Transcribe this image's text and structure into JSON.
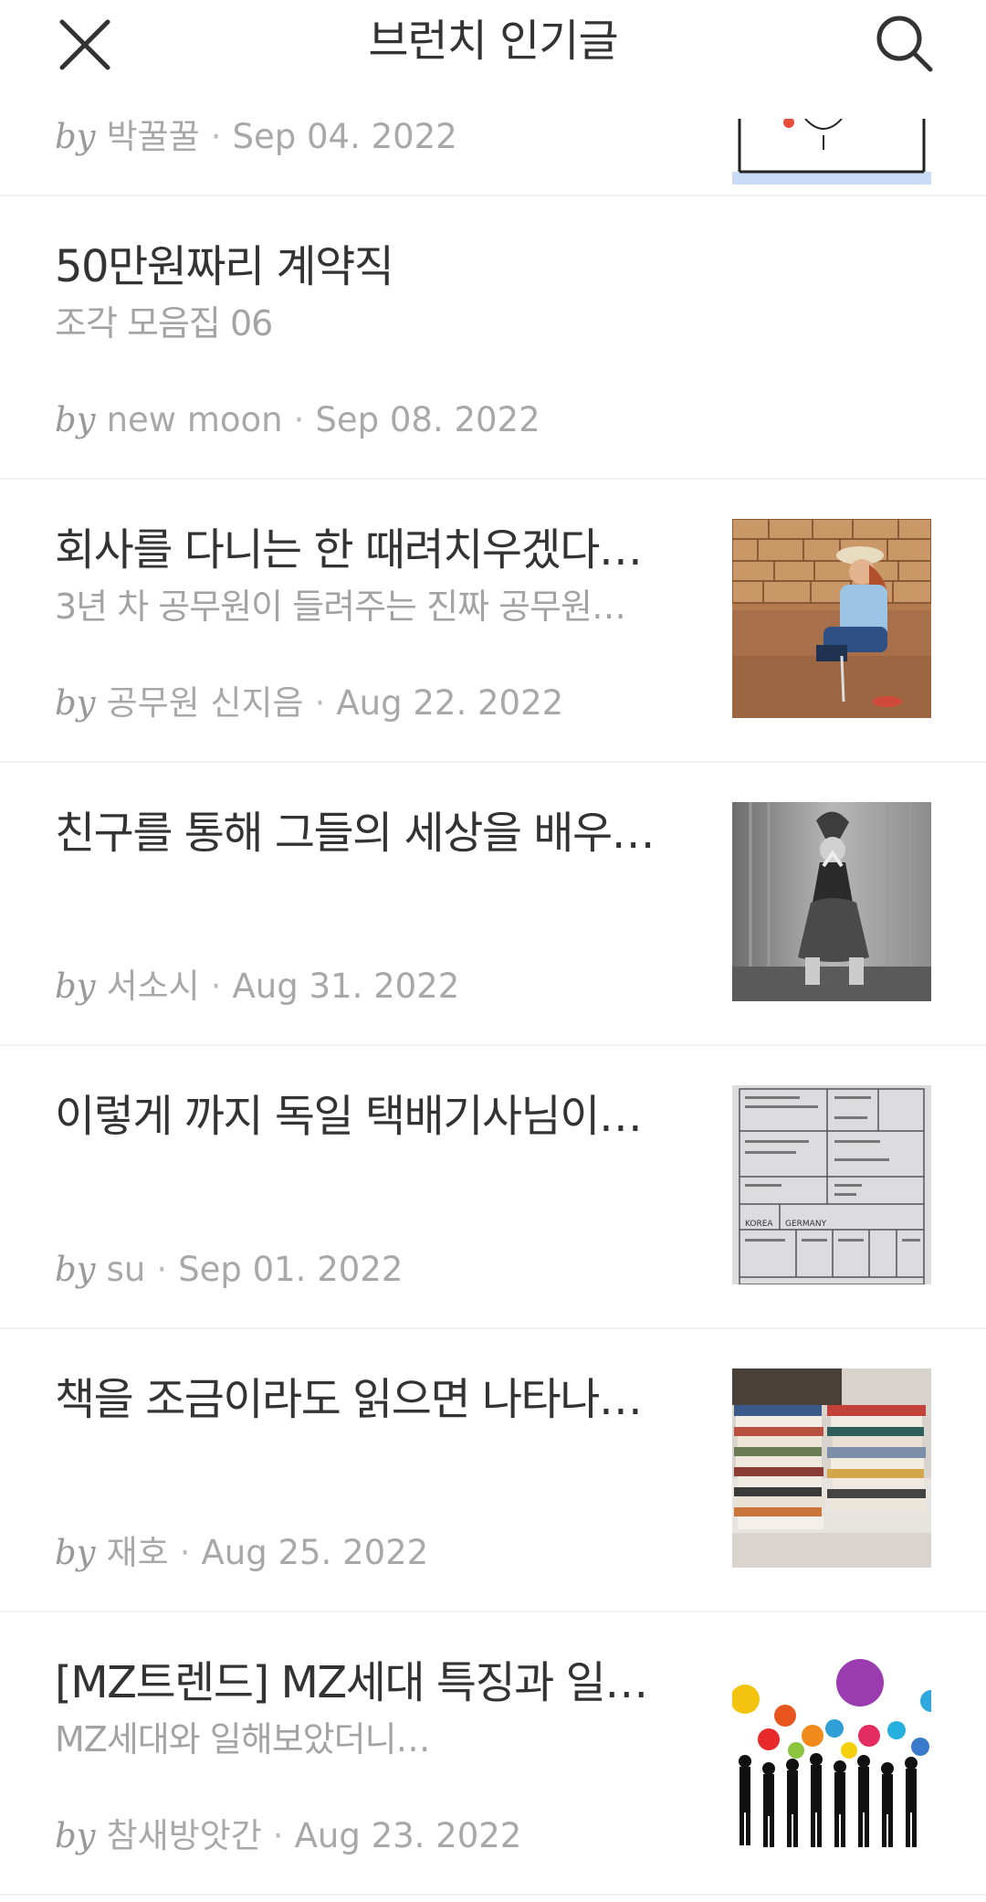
{
  "header": {
    "title": "브런치 인기글",
    "close_icon": "close-icon",
    "search_icon": "search-icon"
  },
  "partial_item": {
    "author": "박꿀꿀",
    "date": "Sep 04. 2022"
  },
  "by_label": "by",
  "items": [
    {
      "title": "50만원짜리 계약직",
      "subtitle": "조각 모음집 06",
      "author": "new moon",
      "date": "Sep 08. 2022",
      "thumb": "none"
    },
    {
      "title": "회사를 다니는 한 때려치우겠다…",
      "subtitle": "3년 차 공무원이 들려주는 진짜 공무원…",
      "author": "공무원 신지음",
      "date": "Aug 22. 2022",
      "thumb": "gardening-photo"
    },
    {
      "title": "친구를 통해 그들의 세상을 배우…",
      "subtitle": "",
      "author": "서소시",
      "date": "Aug 31. 2022",
      "thumb": "dancer-photo"
    },
    {
      "title": "이렇게 까지 독일 택배기사님이…",
      "subtitle": "",
      "author": "su",
      "date": "Sep 01. 2022",
      "thumb": "shipping-form-photo"
    },
    {
      "title": "책을 조금이라도 읽으면 나타나…",
      "subtitle": "",
      "author": "재호",
      "date": "Aug 25. 2022",
      "thumb": "books-photo"
    },
    {
      "title": "[MZ트렌드] MZ세대 특징과 일…",
      "subtitle": "MZ세대와 일해보았더니…",
      "author": "참새방앗간",
      "date": "Aug 23. 2022",
      "thumb": "crowd-illustration"
    }
  ],
  "thumb_text": {
    "form_korea": "KOREA",
    "form_germany": "GERMANY"
  }
}
